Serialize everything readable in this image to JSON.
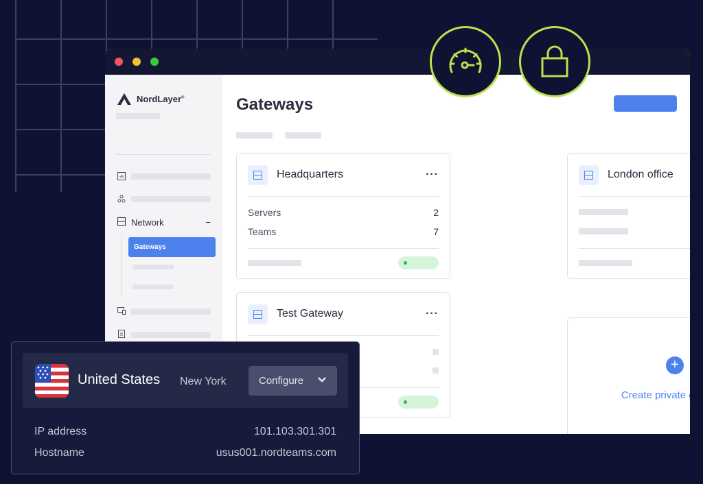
{
  "brand": {
    "name": "NordLayer",
    "mark": "®"
  },
  "sidebar": {
    "network_label": "Network",
    "network_toggle": "−",
    "active_item": "Gateways"
  },
  "main": {
    "title": "Gateways",
    "cards": [
      {
        "title": "Headquarters",
        "rows": [
          {
            "label": "Servers",
            "value": "2"
          },
          {
            "label": "Teams",
            "value": "7"
          }
        ]
      },
      {
        "title": "London office"
      },
      {
        "title": "Test Gateway"
      }
    ],
    "more_label": "···",
    "create_label": "Create private gateway",
    "create_icon": "+"
  },
  "location_panel": {
    "country": "United States",
    "city": "New York",
    "configure_label": "Configure",
    "ip_label": "IP address",
    "ip_value": "101.103.301.301",
    "hostname_label": "Hostname",
    "hostname_value": "usus001.nordteams.com"
  },
  "colors": {
    "accent": "#4d82ee",
    "badge_ring": "#b9e34d",
    "status_ok": "#2fb84a"
  }
}
